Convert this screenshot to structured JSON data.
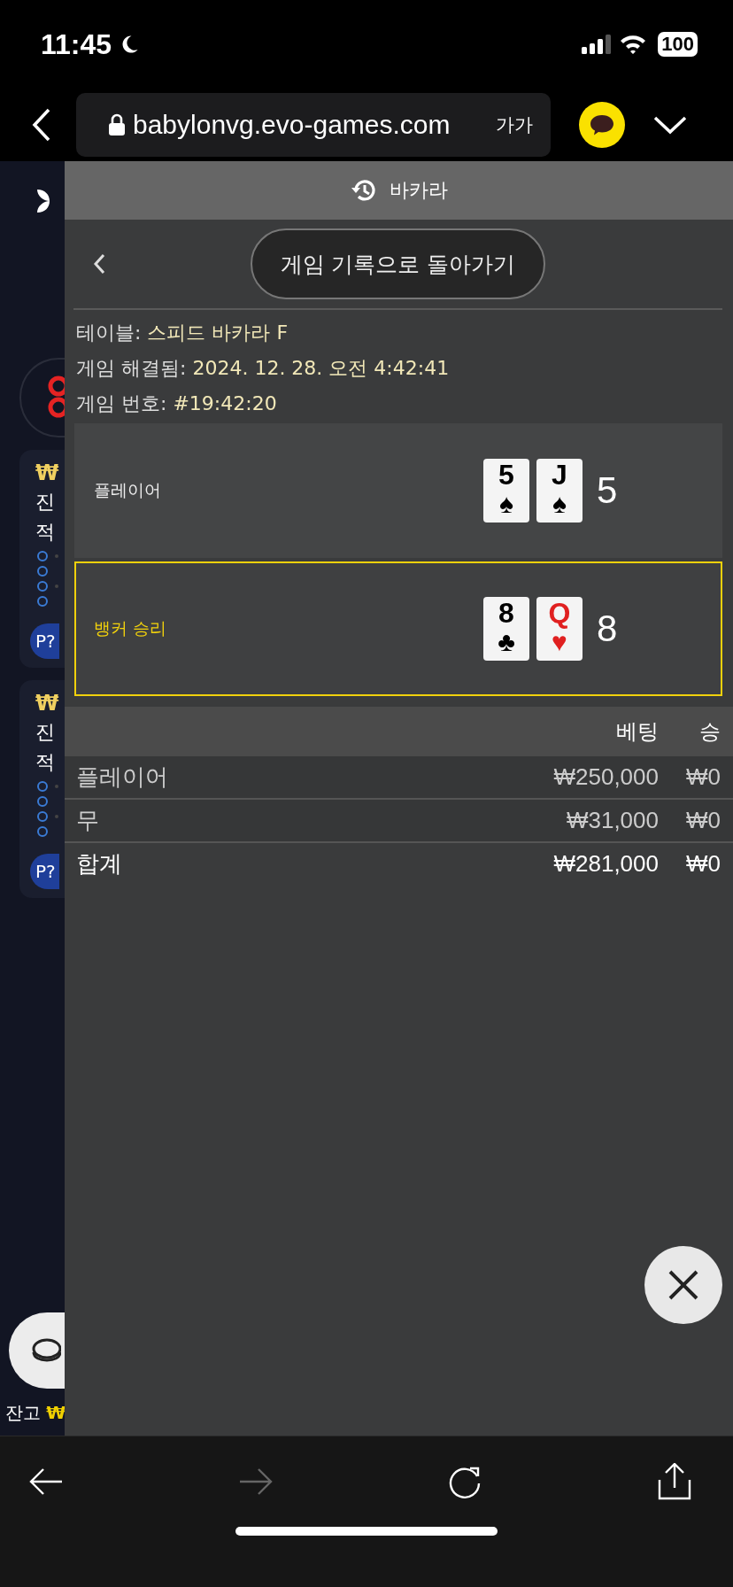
{
  "status_bar": {
    "time": "11:45",
    "battery": "100"
  },
  "browser": {
    "url": "babylonvg.evo-games.com",
    "text_size_button": "가가"
  },
  "background_strip": {
    "cards": [
      {
        "currency": "₩",
        "lines": [
          "진",
          "적"
        ],
        "chip": "P?"
      },
      {
        "currency": "₩",
        "lines": [
          "진",
          "적"
        ],
        "chip": "P?"
      }
    ],
    "balance_label": "잔고",
    "balance_currency": "₩"
  },
  "panel": {
    "title": "바카라",
    "back_button": "게임 기록으로 돌아가기",
    "info": [
      {
        "label": "테이블:",
        "value": "스피드 바카라 F"
      },
      {
        "label": "게임 해결됨:",
        "value": "2024. 12. 28. 오전 4:42:41"
      },
      {
        "label": "게임 번호:",
        "value": "#19:42:20"
      }
    ],
    "hands": [
      {
        "label": "플레이어",
        "winner": false,
        "score": "5",
        "cards": [
          {
            "rank": "5",
            "suit": "♠",
            "red": false
          },
          {
            "rank": "J",
            "suit": "♠",
            "red": false
          }
        ]
      },
      {
        "label": "뱅커 승리",
        "winner": true,
        "score": "8",
        "cards": [
          {
            "rank": "8",
            "suit": "♣",
            "red": false
          },
          {
            "rank": "Q",
            "suit": "♥",
            "red": true
          }
        ]
      }
    ],
    "bets": {
      "columns": [
        "베팅",
        "승"
      ],
      "rows": [
        {
          "name": "플레이어",
          "bet": "₩250,000",
          "win": "₩0",
          "kind": "bet"
        },
        {
          "name": "무",
          "bet": "₩31,000",
          "win": "₩0",
          "kind": "bet"
        },
        {
          "name": "합계",
          "bet": "₩281,000",
          "win": "₩0",
          "kind": "total"
        }
      ]
    }
  }
}
